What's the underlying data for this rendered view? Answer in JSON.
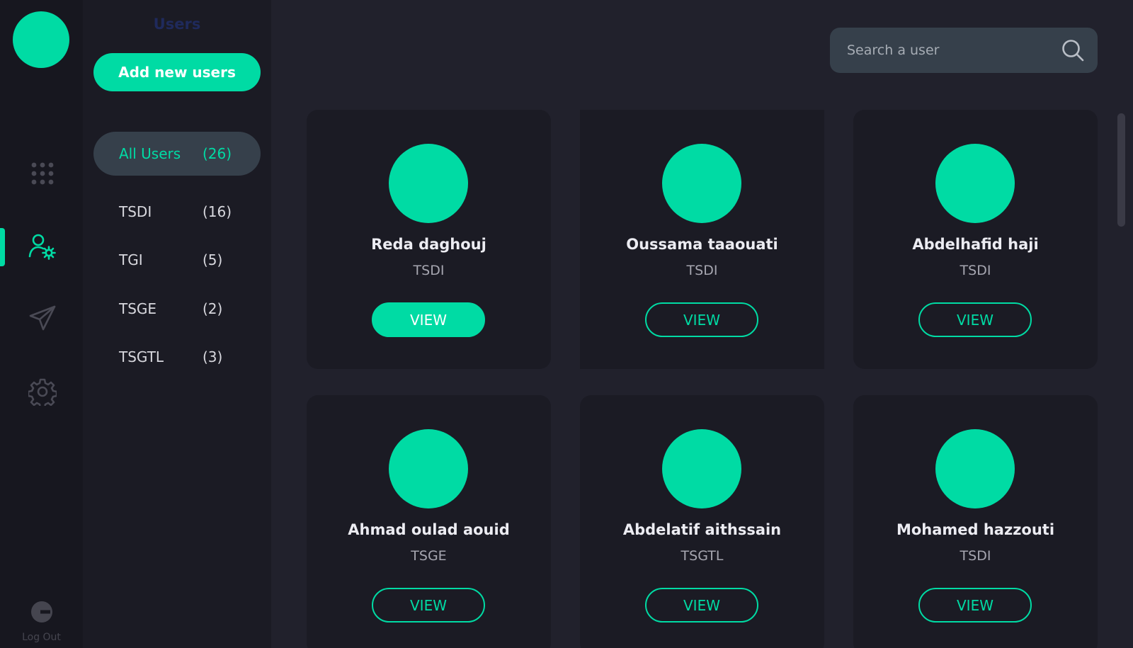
{
  "rail": {
    "items": [
      {
        "icon": "grid-dots-icon",
        "active": false
      },
      {
        "icon": "user-settings-icon",
        "active": true
      },
      {
        "icon": "send-icon",
        "active": false
      },
      {
        "icon": "gear-icon",
        "active": false
      }
    ],
    "logout_icon": "logout-icon",
    "logout_label": "Log Out"
  },
  "panel": {
    "title": "Users",
    "add_button": "Add new users",
    "filters": [
      {
        "name": "All Users",
        "count": "(26)",
        "active": true
      },
      {
        "name": "TSDI",
        "count": "(16)",
        "active": false
      },
      {
        "name": "TGI",
        "count": "(5)",
        "active": false
      },
      {
        "name": "TSGE",
        "count": "(2)",
        "active": false
      },
      {
        "name": "TSGTL",
        "count": "(3)",
        "active": false
      }
    ]
  },
  "search": {
    "placeholder": "Search a user",
    "icon": "search-icon"
  },
  "users": [
    {
      "name": "Reda daghouj",
      "group": "TSDI",
      "button": "VIEW"
    },
    {
      "name": "Oussama taaouati",
      "group": "TSDI",
      "button": "VIEW"
    },
    {
      "name": "Abdelhafid haji",
      "group": "TSDI",
      "button": "VIEW"
    },
    {
      "name": "Ahmad oulad aouid",
      "group": "TSGE",
      "button": "VIEW"
    },
    {
      "name": "Abdelatif aithssain",
      "group": "TSGTL",
      "button": "VIEW"
    },
    {
      "name": "Mohamed hazzouti",
      "group": "TSDI",
      "button": "VIEW"
    }
  ],
  "colors": {
    "accent": "#00dba4",
    "background": "#21212c",
    "rail": "#17171f",
    "panel": "#1b1b24",
    "active_filter": "#36404b"
  }
}
